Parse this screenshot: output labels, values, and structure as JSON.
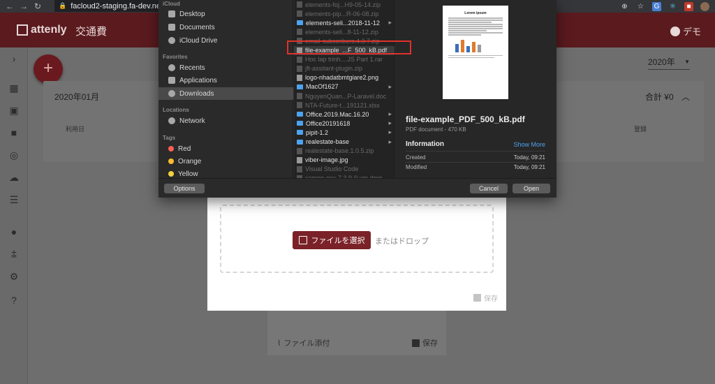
{
  "browser": {
    "back": "←",
    "forward": "→",
    "reload": "↻",
    "url": "facloud2-staging.fa-dev.net/",
    "icons": [
      "add-circle-icon",
      "star-icon",
      "translate-icon",
      "react-icon",
      "extension-icon",
      "profile-icon"
    ]
  },
  "app": {
    "logo_text": "attenly",
    "title": "交通費",
    "user_name": "デモ"
  },
  "main": {
    "year": "2020年",
    "fab_label": "+",
    "card": {
      "month": "2020年01月",
      "total": "合計 ¥0",
      "col_date": "利用日",
      "col_register": "登録"
    }
  },
  "upload": {
    "pick_button": "ファイルを選択",
    "or_drop": "またはドロップ",
    "save": "保存",
    "attach": "ファイル添付",
    "save2": "保存"
  },
  "picker": {
    "sidebar": {
      "icloud_header": "iCloud",
      "icloud_items": [
        "Desktop",
        "Documents",
        "iCloud Drive"
      ],
      "favorites_header": "Favorites",
      "favorite_items": [
        "Recents",
        "Applications",
        "Downloads"
      ],
      "locations_header": "Locations",
      "location_items": [
        "Network"
      ],
      "tags_header": "Tags",
      "tags": [
        {
          "name": "Red",
          "color": "#ff5f57"
        },
        {
          "name": "Orange",
          "color": "#febc2e"
        },
        {
          "name": "Yellow",
          "color": "#f4d03f"
        }
      ]
    },
    "files": [
      {
        "name": "elements-foj...H9-05-14.zip",
        "dim": true,
        "folder": false
      },
      {
        "name": "elements-pip...R-06-08.zip",
        "dim": true,
        "folder": false
      },
      {
        "name": "elements-seli...2018-11-12",
        "dim": false,
        "folder": true
      },
      {
        "name": "elements-seli...8-11-12.zip",
        "dim": true,
        "folder": false
      },
      {
        "name": "email-subscribers.4.3.7.zip",
        "dim": true,
        "folder": false
      },
      {
        "name": "file-example_...F_500_kB.pdf",
        "dim": false,
        "folder": false,
        "selected": true
      },
      {
        "name": "Hoc lap trinh....JS Part 1.rar",
        "dim": true,
        "folder": false
      },
      {
        "name": "jft-assitant-plugin.zip",
        "dim": true,
        "folder": false
      },
      {
        "name": "logo-nhadatbmtgiare2.png",
        "dim": false,
        "folder": false
      },
      {
        "name": "MacOf1627",
        "dim": false,
        "folder": true
      },
      {
        "name": "NguyenQuan...P-Laravel.doc",
        "dim": true,
        "folder": false
      },
      {
        "name": "NTA-Future-t...191121.xlsx",
        "dim": true,
        "folder": false
      },
      {
        "name": "Office.2019.Mac.16.20",
        "dim": false,
        "folder": true
      },
      {
        "name": "Office20191618",
        "dim": false,
        "folder": true
      },
      {
        "name": "pipit-1.2",
        "dim": false,
        "folder": true
      },
      {
        "name": "realestate-base",
        "dim": false,
        "folder": true
      },
      {
        "name": "realestate-base.1.0.5.zip",
        "dim": true,
        "folder": false
      },
      {
        "name": "viber-image.jpg",
        "dim": false,
        "folder": false
      },
      {
        "name": "Visual Studio Code",
        "dim": true,
        "folder": false
      },
      {
        "name": "xampp-osx-7.3.9-0-vm.dmg",
        "dim": true,
        "folder": false
      }
    ],
    "preview": {
      "thumb_title": "Lorem ipsum",
      "name": "file-example_PDF_500_kB.pdf",
      "kind": "PDF document - 470 KB",
      "info_header": "Information",
      "show_more": "Show More",
      "created_label": "Created",
      "created_value": "Today, 09:21",
      "modified_label": "Modified",
      "modified_value": "Today, 09:21"
    },
    "buttons": {
      "options": "Options",
      "cancel": "Cancel",
      "open": "Open"
    }
  }
}
